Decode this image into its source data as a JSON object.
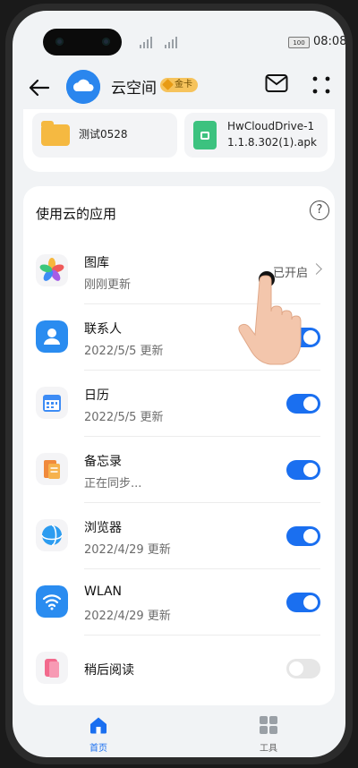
{
  "statusbar": {
    "time": "08:08",
    "battery": "100"
  },
  "header": {
    "title": "云空间",
    "badge": "金卡"
  },
  "files": [
    {
      "name": "测试0528"
    },
    {
      "name_line1": "HwCloudDrive-1",
      "name_line2": "1.1.8.302(1).apk"
    }
  ],
  "section": {
    "title": "使用云的应用",
    "help_glyph": "?"
  },
  "apps": [
    {
      "name": "图库",
      "sub": "刚刚更新",
      "status": "已开启"
    },
    {
      "name": "联系人",
      "sub": "2022/5/5 更新",
      "enabled": true
    },
    {
      "name": "日历",
      "sub": "2022/5/5 更新",
      "enabled": true
    },
    {
      "name": "备忘录",
      "sub": "正在同步...",
      "enabled": true
    },
    {
      "name": "浏览器",
      "sub": "2022/4/29 更新",
      "enabled": true
    },
    {
      "name": "WLAN",
      "sub": "2022/4/29 更新",
      "enabled": true
    },
    {
      "name": "稍后阅读",
      "enabled": false
    }
  ],
  "nav": [
    {
      "label": "首页",
      "active": true
    },
    {
      "label": "工具",
      "active": false
    }
  ],
  "colors": {
    "accent": "#1a6ff0",
    "badge": "#f6c35c"
  }
}
